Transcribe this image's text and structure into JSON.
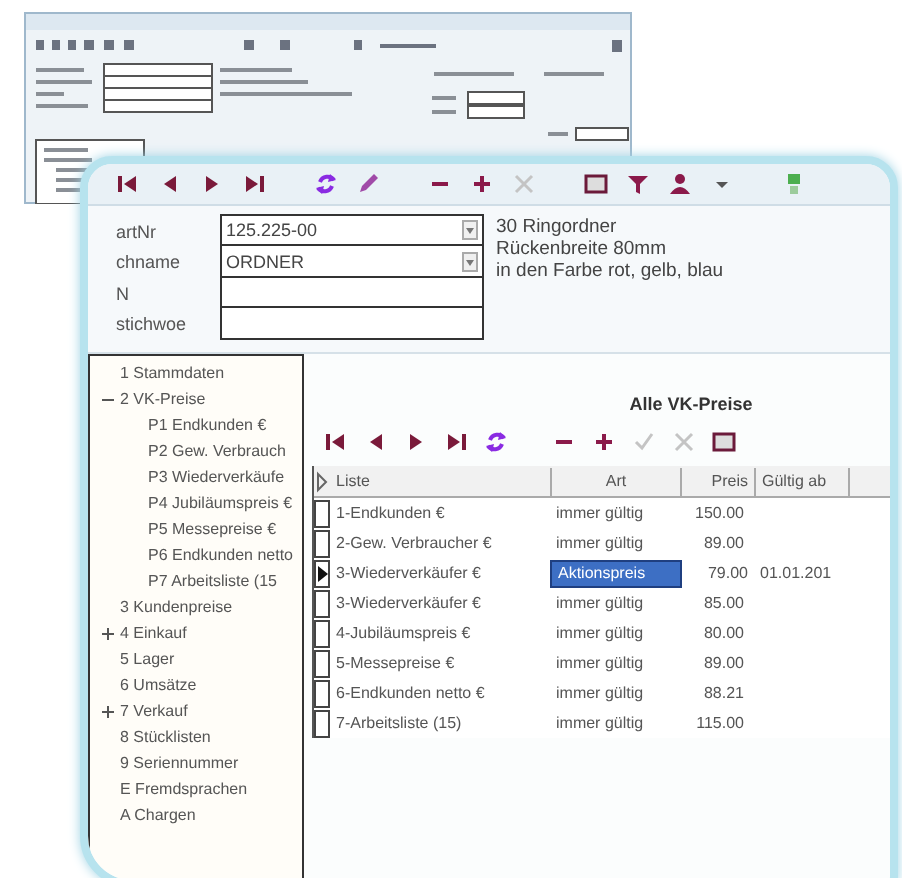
{
  "form": {
    "fields": [
      {
        "label": "artNr",
        "value": "125.225-00",
        "dropdown": true
      },
      {
        "label": "chname",
        "value": "ORDNER",
        "dropdown": true
      },
      {
        "label": "N",
        "dropdown": false
      },
      {
        "label": "stichwoe",
        "dropdown": false
      }
    ],
    "description": [
      "30 Ringordner",
      "Rückenbreite 80mm",
      "in den Farbe rot, gelb, blau"
    ]
  },
  "tree": [
    {
      "label": "1 Stammdaten"
    },
    {
      "label": "2 VK-Preise",
      "expanded": true,
      "children": [
        {
          "label": "P1 Endkunden €"
        },
        {
          "label": "P2 Gew. Verbrauch"
        },
        {
          "label": "P3 Wiederverkäufe"
        },
        {
          "label": "P4 Jubiläumspreis €"
        },
        {
          "label": "P5 Messepreise €"
        },
        {
          "label": "P6 Endkunden netto"
        },
        {
          "label": "P7 Arbeitsliste (15"
        }
      ]
    },
    {
      "label": "3 Kundenpreise"
    },
    {
      "label": "4 Einkauf",
      "expanded": false
    },
    {
      "label": "5 Lager"
    },
    {
      "label": "6 Umsätze"
    },
    {
      "label": "7 Verkauf",
      "expanded": false
    },
    {
      "label": "8 Stücklisten"
    },
    {
      "label": "9 Seriennummer"
    },
    {
      "label": "E Fremdsprachen"
    },
    {
      "label": "A Chargen"
    }
  ],
  "table": {
    "title": "Alle VK-Preise",
    "columns": [
      "Liste",
      "Art",
      "Preis",
      "Gültig ab"
    ],
    "rows": [
      {
        "cells": [
          "1-Endkunden €",
          "immer gültig",
          "150.00",
          ""
        ],
        "selected": false
      },
      {
        "cells": [
          "2-Gew. Verbraucher €",
          "immer gültig",
          "89.00",
          ""
        ],
        "selected": false
      },
      {
        "cells": [
          "3-Wiederverkäufer €",
          "Aktionspreis",
          "79.00",
          "01.01.201"
        ],
        "selected": true
      },
      {
        "cells": [
          "3-Wiederverkäufer €",
          "immer gültig",
          "85.00",
          ""
        ],
        "selected": false
      },
      {
        "cells": [
          "4-Jubiläumspreis €",
          "immer gültig",
          "80.00",
          ""
        ],
        "selected": false
      },
      {
        "cells": [
          "5-Messepreise €",
          "immer gültig",
          "89.00",
          ""
        ],
        "selected": false
      },
      {
        "cells": [
          "6-Endkunden netto €",
          "immer gültig",
          "88.21",
          ""
        ],
        "selected": false
      },
      {
        "cells": [
          "7-Arbeitsliste (15)",
          "immer gültig",
          "115.00",
          ""
        ],
        "selected": false
      }
    ]
  }
}
